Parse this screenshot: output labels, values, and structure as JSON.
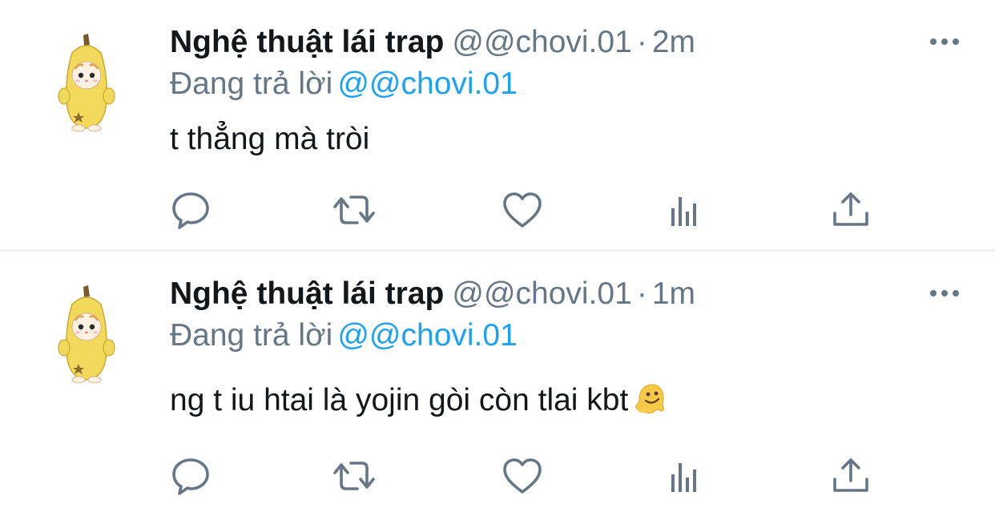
{
  "tweets": [
    {
      "display_name": "Nghệ thuật lái trap",
      "handle": "@@chovi.01",
      "separator": "·",
      "time": "2m",
      "reply_prefix": "Đang trả lời",
      "reply_mention": "@@chovi.01",
      "text": "t thẳng mà tròi",
      "emoji": ""
    },
    {
      "display_name": "Nghệ thuật lái trap",
      "handle": "@@chovi.01",
      "separator": "·",
      "time": "1m",
      "reply_prefix": "Đang trả lời",
      "reply_mention": "@@chovi.01",
      "text": "ng t iu htai là yojin gòi còn tlai kbt",
      "emoji": "melting-face-emoji"
    }
  ],
  "icons": {
    "more": "more-horizontal-icon",
    "reply": "reply-bubble-icon",
    "retweet": "retweet-icon",
    "like": "heart-icon",
    "views": "views-bar-chart-icon",
    "share": "share-upload-icon"
  },
  "colors": {
    "name": "#14171a",
    "secondary": "#657786",
    "mention": "#1da1f2",
    "icon": "#657786",
    "divider": "#eff3f4",
    "avatar_banana": "#f2d95c"
  }
}
